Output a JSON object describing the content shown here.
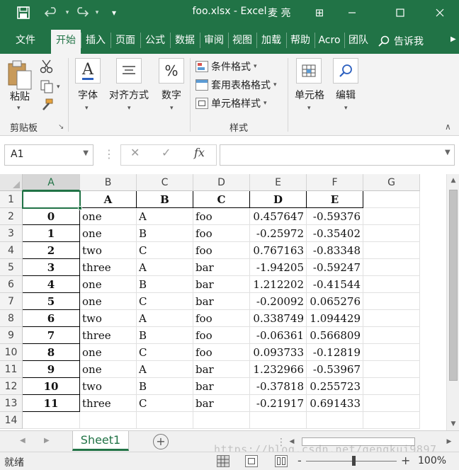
{
  "window": {
    "title": "foo.xlsx  -  Excel",
    "user": "麦 亮",
    "restore_glyph": "⊞",
    "qat": {
      "save_icon": "save-icon",
      "undo_icon": "undo-icon",
      "redo_icon": "redo-icon",
      "customize": "▾"
    }
  },
  "ribbon_tabs": [
    "文件",
    "开始",
    "插入",
    "页面",
    "公式",
    "数据",
    "审阅",
    "视图",
    "加载",
    "帮助",
    "Acro",
    "团队"
  ],
  "active_tab": "开始",
  "tell_me": "告诉我",
  "ribbon": {
    "paste": "粘贴",
    "clipboard_group": "剪贴板",
    "font": "字体",
    "alignment": "对齐方式",
    "number": "数字",
    "conditional_format": "条件格式",
    "format_table": "套用表格格式",
    "cell_styles": "单元格样式",
    "styles_group": "样式",
    "cells": "单元格",
    "editing": "编辑",
    "font_icon_letter": "A",
    "number_icon": "%"
  },
  "formula_bar": {
    "name_box": "A1",
    "cancel": "✕",
    "enter": "✓",
    "fx": "fx",
    "formula": ""
  },
  "columns": [
    "A",
    "B",
    "C",
    "D",
    "E",
    "F",
    "G"
  ],
  "selected_column": "A",
  "rows": [
    [
      "",
      "A",
      "B",
      "C",
      "D",
      "E"
    ],
    [
      "0",
      "one",
      "A",
      "foo",
      "0.457647",
      "-0.59376"
    ],
    [
      "1",
      "one",
      "B",
      "foo",
      "-0.25972",
      "-0.35402"
    ],
    [
      "2",
      "two",
      "C",
      "foo",
      "0.767163",
      "-0.83348"
    ],
    [
      "3",
      "three",
      "A",
      "bar",
      "-1.94205",
      "-0.59247"
    ],
    [
      "4",
      "one",
      "B",
      "bar",
      "1.212202",
      "-0.41544"
    ],
    [
      "5",
      "one",
      "C",
      "bar",
      "-0.20092",
      "0.065276"
    ],
    [
      "6",
      "two",
      "A",
      "foo",
      "0.338749",
      "1.094429"
    ],
    [
      "7",
      "three",
      "B",
      "foo",
      "-0.06361",
      "0.566809"
    ],
    [
      "8",
      "one",
      "C",
      "foo",
      "0.093733",
      "-0.12819"
    ],
    [
      "9",
      "one",
      "A",
      "bar",
      "1.232966",
      "-0.53967"
    ],
    [
      "10",
      "two",
      "B",
      "bar",
      "-0.37818",
      "0.255723"
    ],
    [
      "11",
      "three",
      "C",
      "bar",
      "-0.21917",
      "0.691433"
    ],
    [
      "",
      "",
      "",
      "",
      "",
      ""
    ]
  ],
  "row_numbers": [
    "1",
    "2",
    "3",
    "4",
    "5",
    "6",
    "7",
    "8",
    "9",
    "10",
    "11",
    "12",
    "13",
    "14"
  ],
  "sheet_tabs": [
    "Sheet1"
  ],
  "add_sheet": "+",
  "watermark": "https://blog.csdn.net/gengkui9897",
  "status": {
    "ready": "就绪",
    "zoom_minus": "-",
    "zoom_plus": "+",
    "zoom": "100%",
    "zoom_level": 1.0
  },
  "colors": {
    "accent": "#217346"
  }
}
